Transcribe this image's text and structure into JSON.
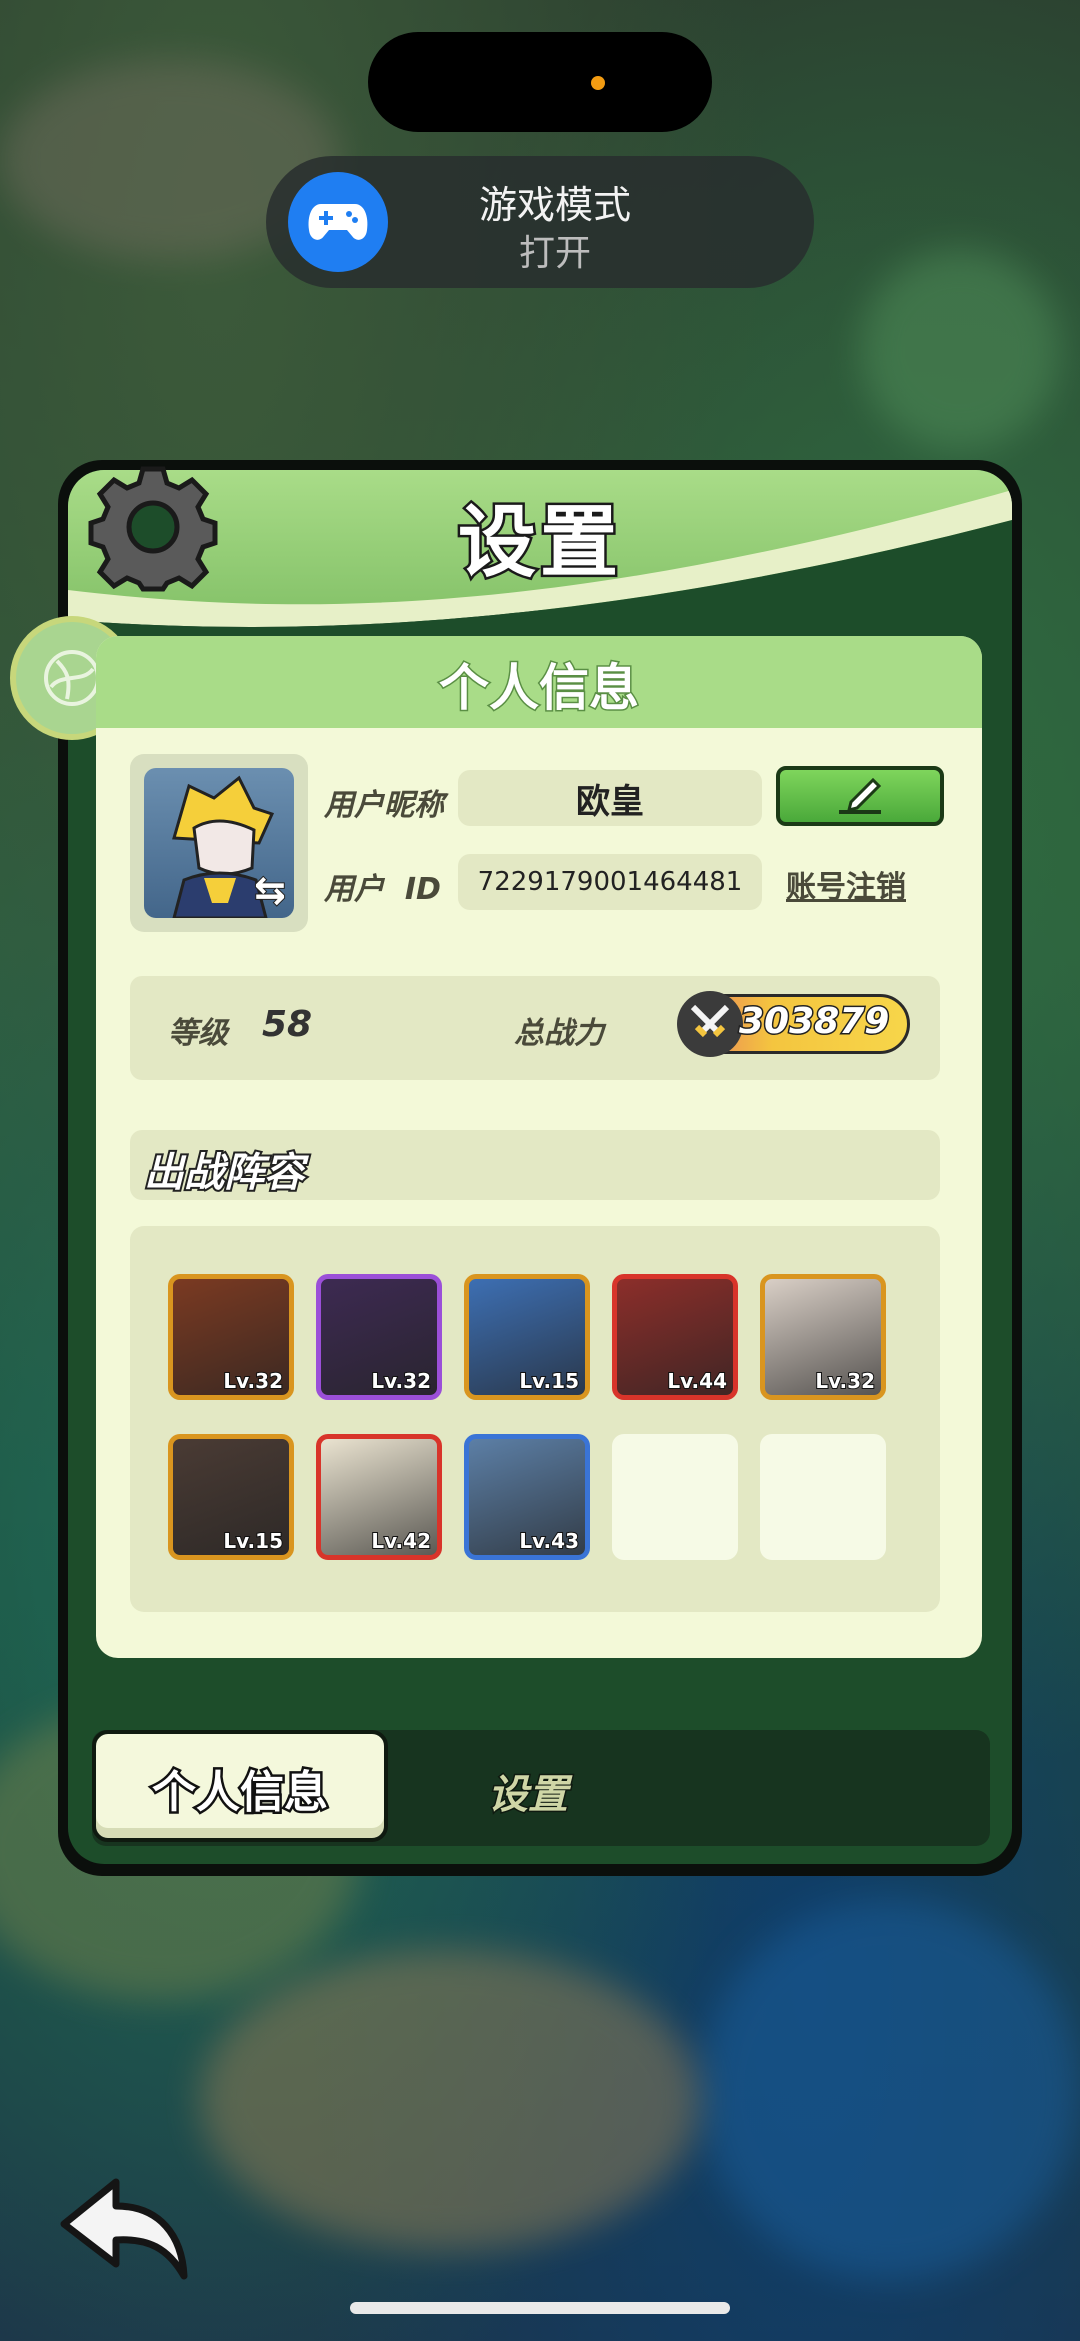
{
  "status_toast": {
    "title": "游戏模式",
    "subtitle": "打开"
  },
  "panel": {
    "title": "设置"
  },
  "card": {
    "title": "个人信息"
  },
  "profile": {
    "nickname_label": "用户昵称",
    "nickname": "欧皇",
    "id_label": "用户  ID",
    "user_id": "7229179001464481",
    "logout_label": "账号注销",
    "level_label": "等级",
    "level": "58",
    "power_label": "总战力",
    "power": "303879"
  },
  "lineup": {
    "title": "出战阵容",
    "heroes": [
      {
        "level": "Lv.32",
        "frame": "#d9951f",
        "bg": "#7b3a22"
      },
      {
        "level": "Lv.32",
        "frame": "#9b4fd8",
        "bg": "#3d2a52"
      },
      {
        "level": "Lv.15",
        "frame": "#d9951f",
        "bg": "#3d6fb3"
      },
      {
        "level": "Lv.44",
        "frame": "#d8342a",
        "bg": "#8c2e2a"
      },
      {
        "level": "Lv.32",
        "frame": "#d9951f",
        "bg": "#d9cfc6"
      },
      {
        "level": "Lv.15",
        "frame": "#d9951f",
        "bg": "#4a3b34"
      },
      {
        "level": "Lv.42",
        "frame": "#d8342a",
        "bg": "#eae3d0"
      },
      {
        "level": "Lv.43",
        "frame": "#3a74d6",
        "bg": "#5c7fa6"
      },
      {
        "level": "",
        "frame": "",
        "bg": ""
      },
      {
        "level": "",
        "frame": "",
        "bg": ""
      }
    ]
  },
  "tabs": {
    "active": "个人信息",
    "other": "设置"
  }
}
